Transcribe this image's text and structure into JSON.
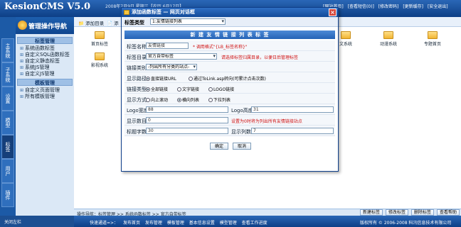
{
  "header": {
    "logo": "KesionCMS V5.0",
    "date": "2008年7月9日 星期三【农历 6月17日】",
    "links": [
      "[网站首页]",
      "[查看短信(0)]",
      "[修改密码]",
      "[更新缓存]",
      "[安全退出]"
    ]
  },
  "sidebar": {
    "brand": "管理操作导航",
    "tabs": [
      "主系统",
      "子系统",
      "设置",
      "模型",
      "标签",
      "用户",
      "插件"
    ],
    "active_tab": "标签",
    "groups": [
      {
        "title": "标签管理",
        "items": [
          "系统函数标签",
          "自定义SQL函数标签",
          "自定义静态标签",
          "系统JS管理",
          "自定义JS管理"
        ]
      },
      {
        "title": "模板管理",
        "items": [
          "自定义页面管理",
          "所有模板管理"
        ]
      }
    ],
    "collapse_label": "关闭左栏"
  },
  "toolbar": {
    "add_dir": "添加目录",
    "add_label": "添"
  },
  "folders": [
    {
      "label": "首页标签"
    },
    {
      "label": "影视系统"
    },
    {
      "label": "文系统"
    },
    {
      "label": "动漫系统"
    },
    {
      "label": "专题首页"
    }
  ],
  "status": {
    "crumbs": "操作导航：标签管理 >> 系统函数标签 >> 官方自带标签",
    "buttons": [
      "新建标签",
      "修改标签",
      "删除标签",
      "查看帮助"
    ]
  },
  "bottom": {
    "quick": [
      "快速通道=>：",
      "发布首页",
      "发布管理",
      "模板管理",
      "基本信息设置",
      "模型管理",
      "查看工作进度"
    ],
    "copyright": "版权所有 © 2006-2008 科汛信息技术有限公司"
  },
  "dialog": {
    "title": "添加函数标签 — 网页对话框",
    "type_label": "标签类型",
    "type_value": "1:友情链接列表",
    "form_header": "新 建 友 情 链 接 列 表 标 签",
    "rows": {
      "name": {
        "label": "标签名称",
        "value": "友情链接",
        "hint": "* 调用格式\"{LB_标签名称}\""
      },
      "dir": {
        "label": "标签目录",
        "value": "官方自带标签",
        "hint": "请选择标签归属目录，以便日后管理标签"
      },
      "category": {
        "label": "链接类别",
        "value": "-列出所有分类的站点-"
      },
      "path": {
        "label": "显示路径",
        "options": [
          "直接链接URL",
          "通过ToLink.asp转向(可累计点击次数)"
        ],
        "selected": 0
      },
      "linktype": {
        "label": "链接类型",
        "options": [
          "全部链接",
          "文字链接",
          "LOGO链接"
        ],
        "selected": 0
      },
      "display": {
        "label": "显示方式",
        "options": [
          "向上滚动",
          "横向列表",
          "下拉列表"
        ],
        "selected": 1
      },
      "logo_width": {
        "label": "Logo宽度",
        "value": "88"
      },
      "logo_height": {
        "label": "Logo高度",
        "value": "31"
      },
      "count": {
        "label": "显示数目",
        "value": "0",
        "hint": "设置为0时将为列出所有友情链接站点"
      },
      "chars": {
        "label": "标题字数",
        "value": "30"
      },
      "cols": {
        "label": "显示列数",
        "value": "7"
      }
    },
    "ok": "确定",
    "cancel": "取消"
  }
}
